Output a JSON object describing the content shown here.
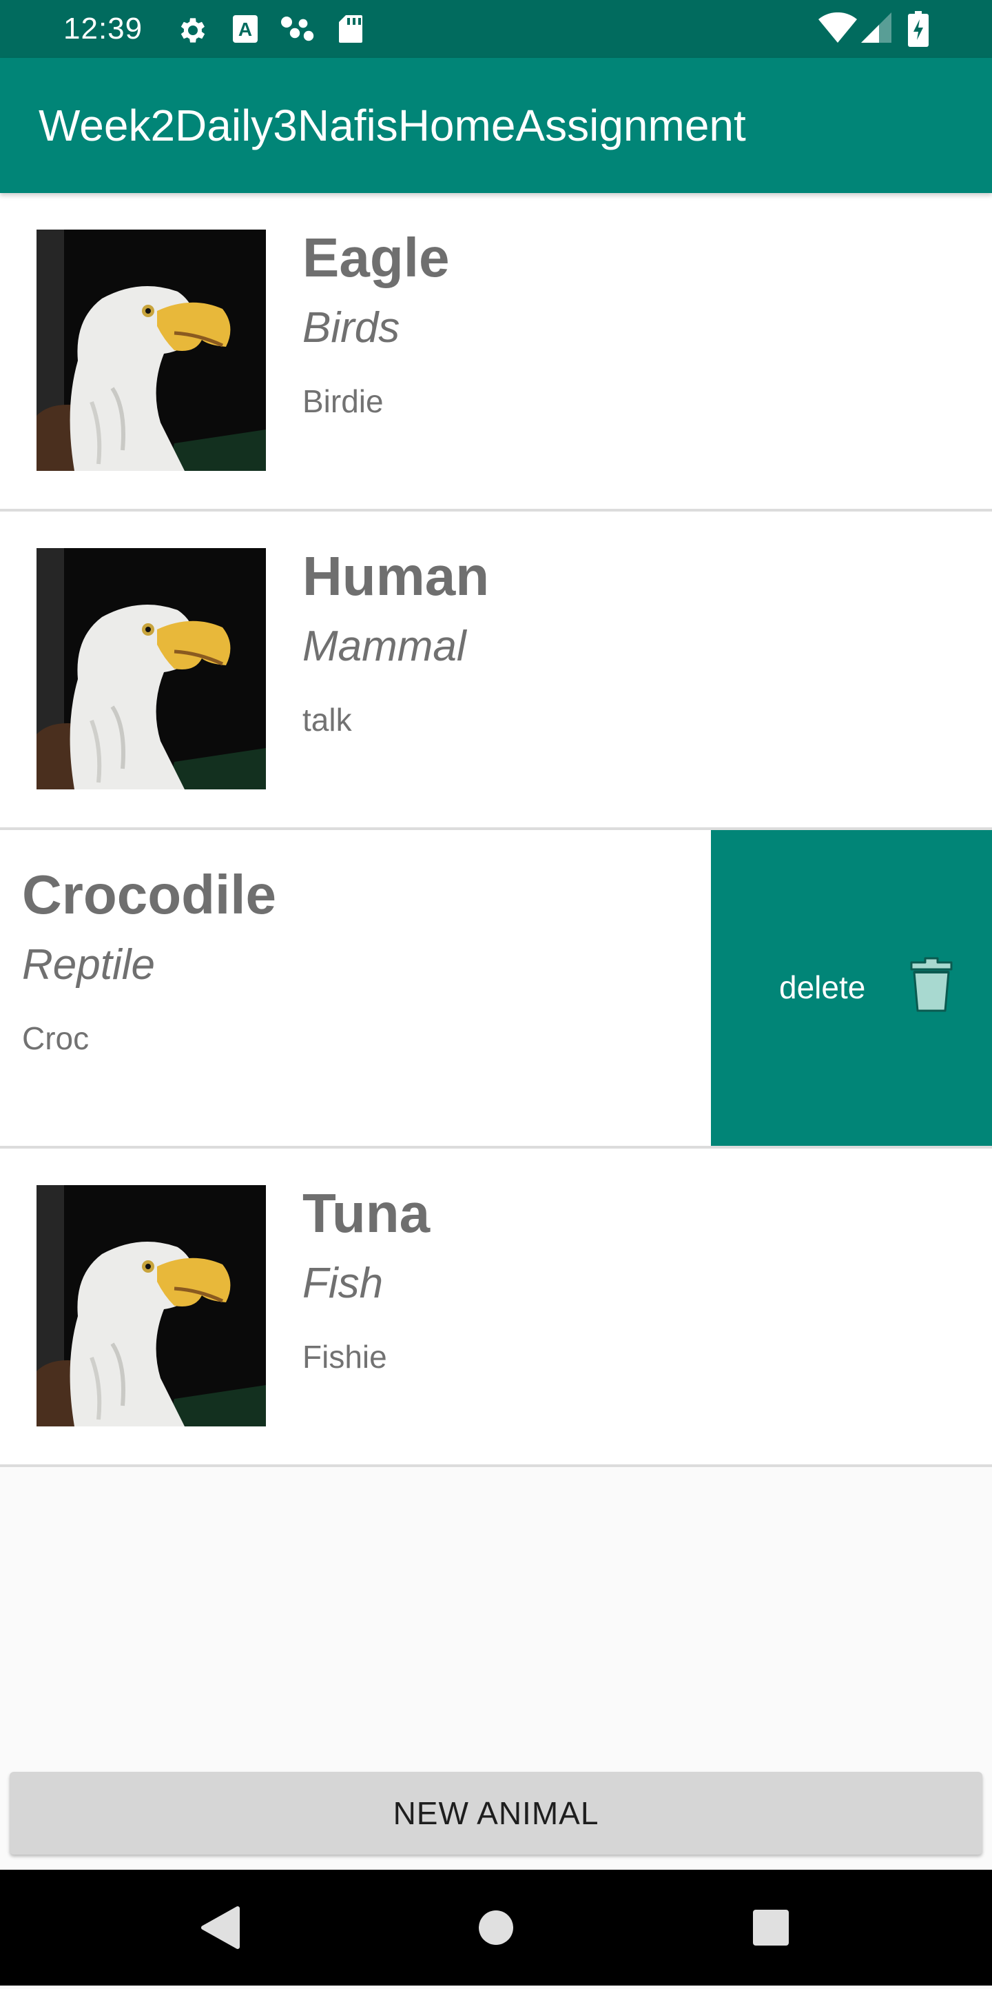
{
  "status_bar": {
    "time": "12:39",
    "left_icons": [
      "gear-icon",
      "a-box-icon",
      "dots-icon",
      "sd-card-icon"
    ],
    "right_icons": [
      "wifi-icon",
      "cell-signal-icon",
      "battery-charging-icon"
    ]
  },
  "app_bar": {
    "title": "Week2Daily3NafisHomeAssignment"
  },
  "animals": [
    {
      "name": "Eagle",
      "category": "Birds",
      "sound": "Birdie",
      "image": "eagle-photo"
    },
    {
      "name": "Human",
      "category": "Mammal",
      "sound": "talk",
      "image": "eagle-photo"
    },
    {
      "name": "Crocodile",
      "category": "Reptile",
      "sound": "Croc",
      "swiped": true,
      "action_label": "delete",
      "action_icon": "trash-icon"
    },
    {
      "name": "Tuna",
      "category": "Fish",
      "sound": "Fishie",
      "image": "eagle-photo"
    }
  ],
  "new_animal_button": "NEW ANIMAL",
  "nav_bar": {
    "icons": [
      "back-icon",
      "home-icon",
      "recents-icon"
    ]
  },
  "colors": {
    "primary": "#018577",
    "primary_dark": "#016B5E",
    "background": "#fafafa",
    "text_gray": "#707070",
    "button_gray": "#d6d6d6"
  }
}
